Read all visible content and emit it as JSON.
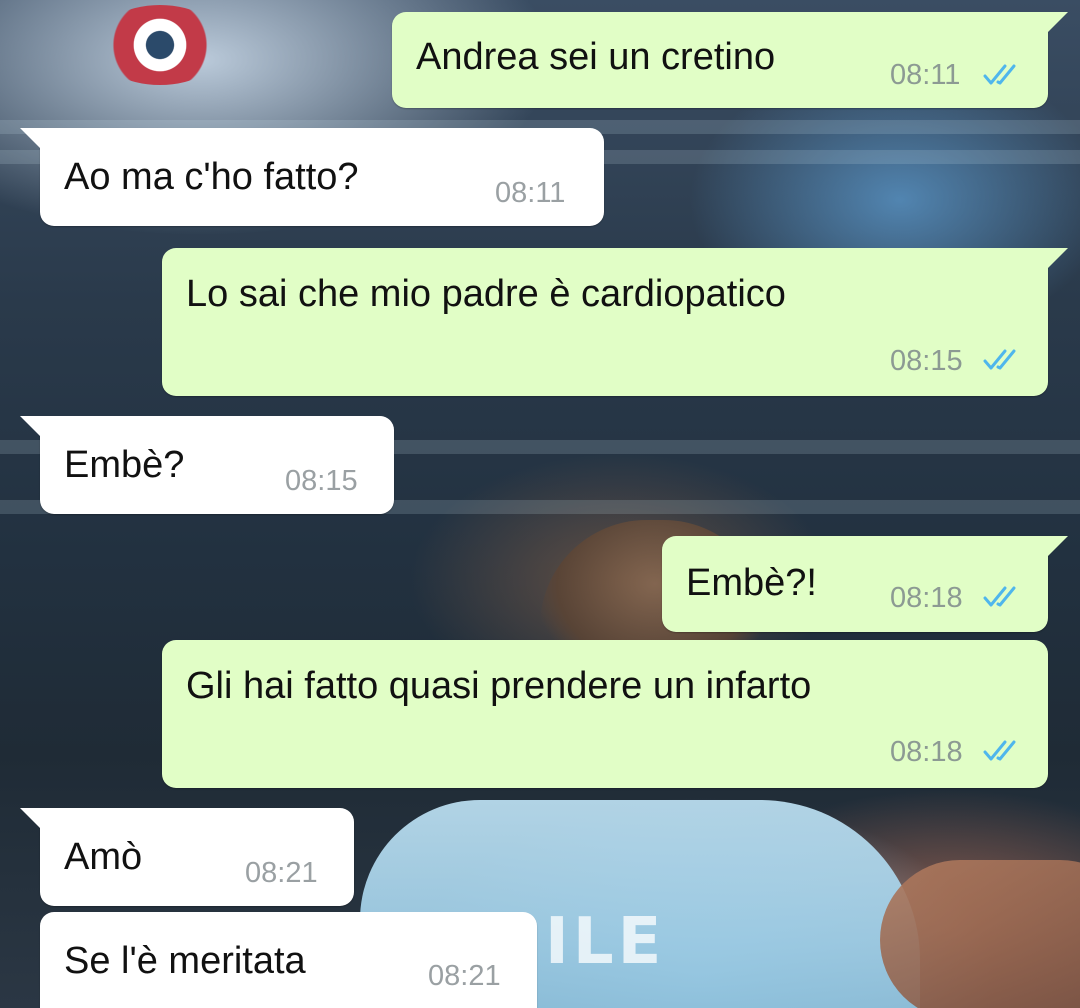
{
  "messages": [
    {
      "direction": "out",
      "text": "Andrea sei un cretino",
      "time": "08:11",
      "status": "read-double-check-icon"
    },
    {
      "direction": "in",
      "text": "Ao ma c'ho fatto?",
      "time": "08:11"
    },
    {
      "direction": "out",
      "text": "Lo sai che mio padre è cardiopatico",
      "time": "08:15",
      "status": "read-double-check-icon"
    },
    {
      "direction": "in",
      "text": "Embè?",
      "time": "08:15"
    },
    {
      "direction": "out",
      "text": "Embè?!",
      "time": "08:18",
      "status": "read-double-check-icon"
    },
    {
      "direction": "out",
      "text": "Gli hai fatto quasi prendere un infarto",
      "time": "08:18",
      "status": "read-double-check-icon"
    },
    {
      "direction": "in",
      "text": "Amò",
      "time": "08:21"
    },
    {
      "direction": "in",
      "text": "Se l'è meritata",
      "time": "08:21"
    }
  ],
  "colors": {
    "outgoing_bubble": "#e1fec6",
    "incoming_bubble": "#ffffff",
    "read_tick": "#4fb6ec",
    "timestamp": "#8c9a93"
  },
  "wallpaper": {
    "jersey_text": "ILE"
  }
}
